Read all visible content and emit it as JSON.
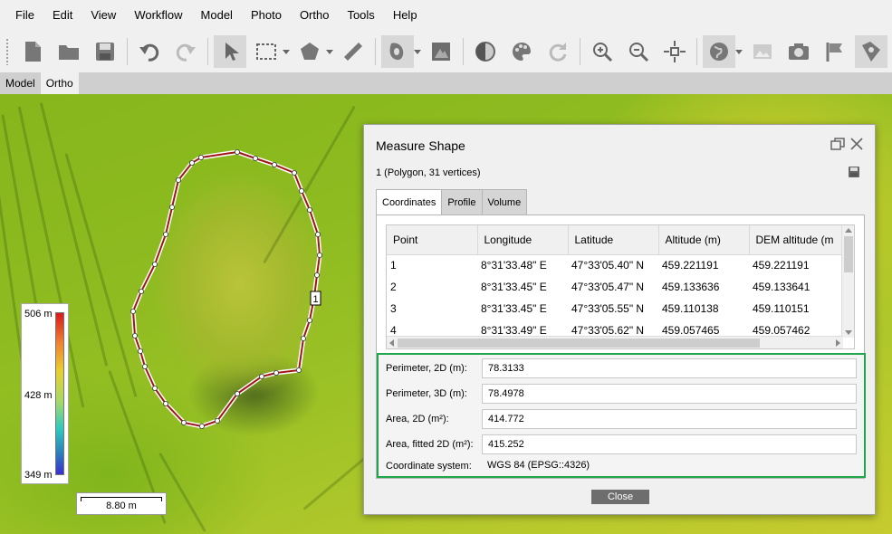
{
  "menu": [
    "File",
    "Edit",
    "View",
    "Workflow",
    "Model",
    "Photo",
    "Ortho",
    "Tools",
    "Help"
  ],
  "toolbar_icons": [
    "new-document-icon",
    "open-folder-icon",
    "save-disk-icon",
    "undo-icon",
    "redo-icon",
    "pointer-icon",
    "rectangle-select-icon",
    "polygon-icon",
    "ruler-icon",
    "mask-shape-icon",
    "edit-image-icon",
    "contrast-icon",
    "palette-icon",
    "refresh-icon",
    "zoom-in-icon",
    "zoom-out-icon",
    "reset-view-icon",
    "globe-icon",
    "image-gallery-icon",
    "camera-icon",
    "flag-icon",
    "map-marker-icon"
  ],
  "view_tabs": [
    "Model",
    "Ortho"
  ],
  "legend": {
    "max": "506 m",
    "mid": "428 m",
    "min": "349 m"
  },
  "scale": "8.80 m",
  "shape_label": "1",
  "dialog": {
    "title": "Measure Shape",
    "subtitle": "1 (Polygon, 31 vertices)",
    "tabs": [
      "Coordinates",
      "Profile",
      "Volume"
    ],
    "columns": [
      "Point",
      "Longitude",
      "Latitude",
      "Altitude (m)",
      "DEM altitude (m"
    ],
    "rows": [
      [
        "1",
        "8°31'33.48\" E",
        "47°33'05.40\" N",
        "459.221191",
        "459.221191"
      ],
      [
        "2",
        "8°31'33.45\" E",
        "47°33'05.47\" N",
        "459.133636",
        "459.133641"
      ],
      [
        "3",
        "8°31'33.45\" E",
        "47°33'05.55\" N",
        "459.110138",
        "459.110151"
      ],
      [
        "4",
        "8°31'33.49\" E",
        "47°33'05.62\" N",
        "459.057465",
        "459.057462"
      ]
    ],
    "stats": {
      "perimeter2d_label": "Perimeter, 2D (m):",
      "perimeter2d": "78.3133",
      "perimeter3d_label": "Perimeter, 3D (m):",
      "perimeter3d": "78.4978",
      "area2d_label": "Area, 2D (m²):",
      "area2d": "414.772",
      "areafit_label": "Area, fitted 2D (m²):",
      "areafit": "415.252",
      "crs_label": "Coordinate system:",
      "crs": "WGS 84 (EPSG::4326)"
    },
    "close_label": "Close"
  }
}
